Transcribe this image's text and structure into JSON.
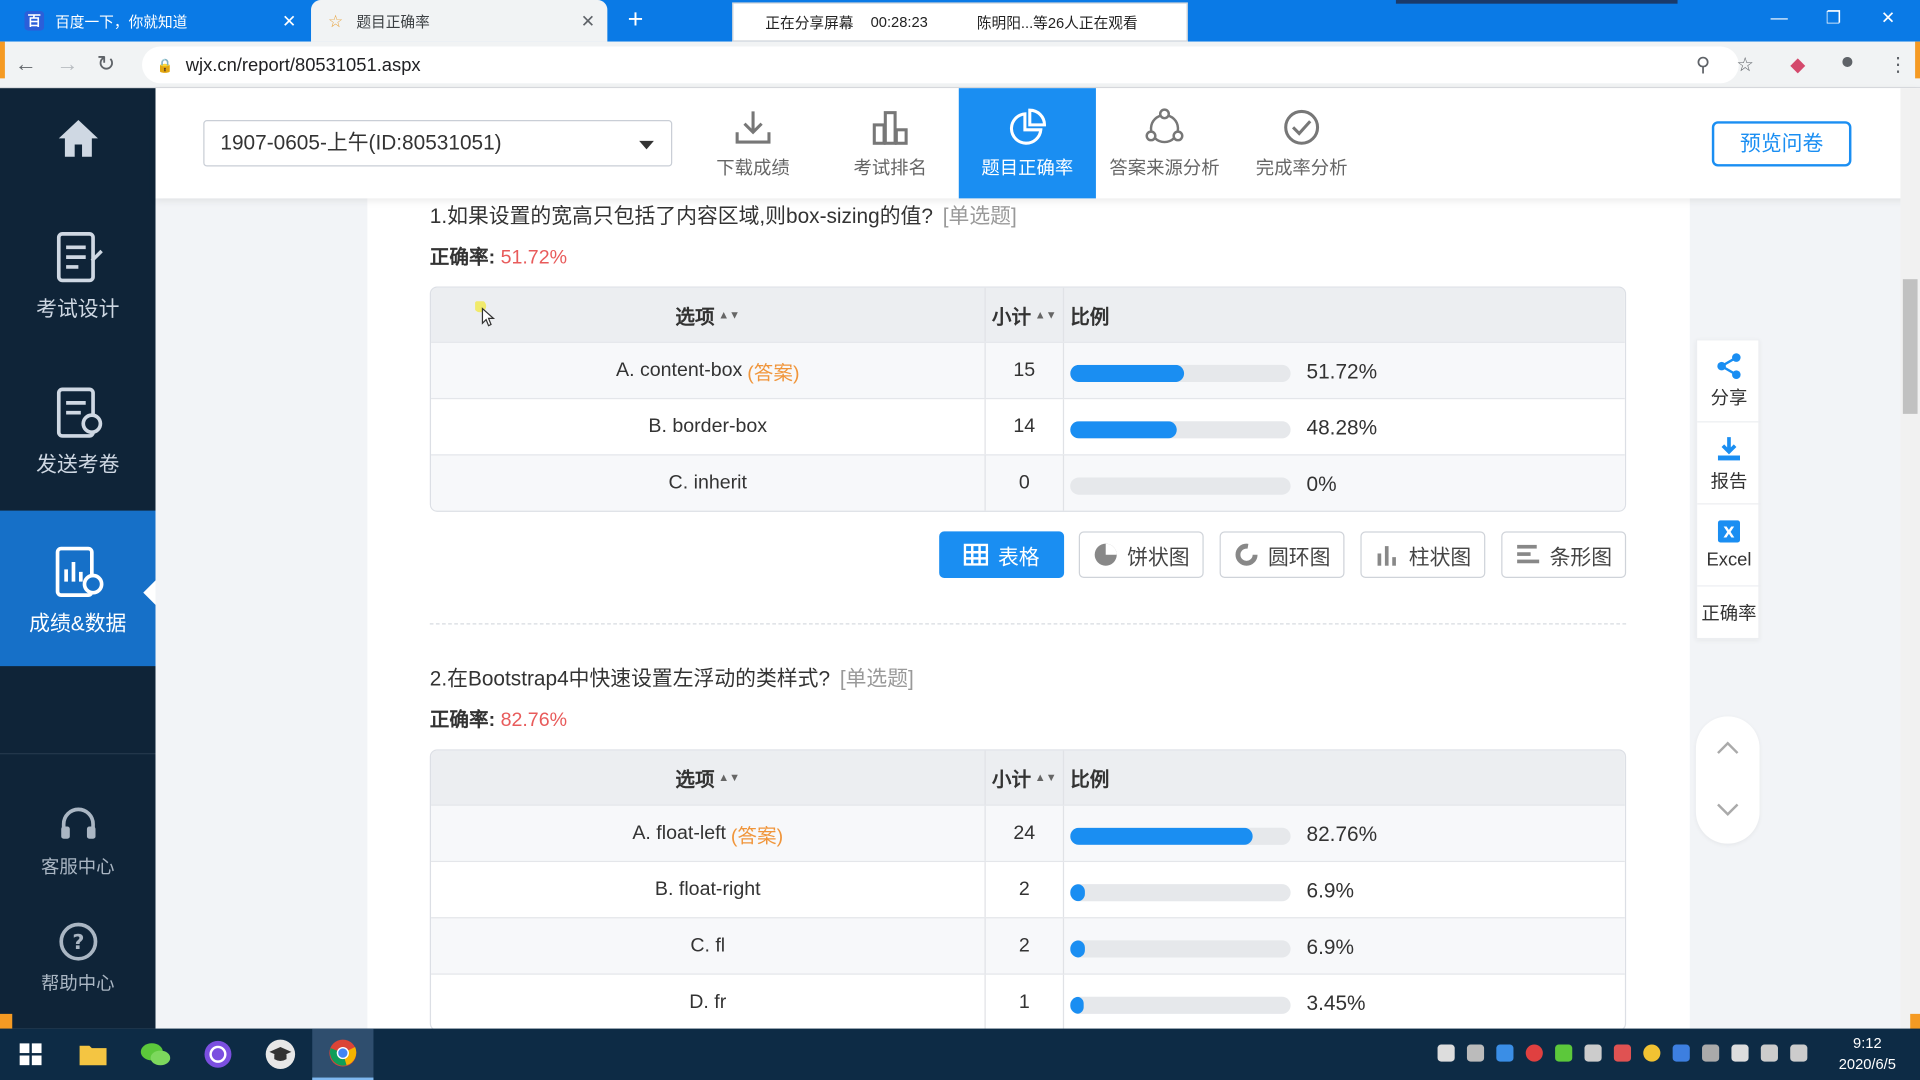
{
  "browser": {
    "tabs": [
      {
        "title": "百度一下，你就知道",
        "favicon": "baidu-paw-icon"
      },
      {
        "title": "题目正确率",
        "favicon": "star-icon"
      }
    ],
    "share_bar": {
      "status": "正在分享屏幕",
      "timer": "00:28:23",
      "viewers": "陈明阳...等26人正在观看"
    },
    "url": "wjx.cn/report/80531051.aspx"
  },
  "sidebar": {
    "items": [
      {
        "label": "",
        "icon": "home-icon"
      },
      {
        "label": "考试设计",
        "icon": "exam-design-icon"
      },
      {
        "label": "发送考卷",
        "icon": "send-paper-icon"
      },
      {
        "label": "成绩&数据",
        "icon": "score-data-icon"
      },
      {
        "label": "客服中心",
        "icon": "headset-icon"
      },
      {
        "label": "帮助中心",
        "icon": "help-icon"
      }
    ]
  },
  "toolbar": {
    "survey_select": "1907-0605-上午(ID:80531051)",
    "buttons": [
      {
        "label": "下载成绩",
        "icon": "download-icon"
      },
      {
        "label": "考试排名",
        "icon": "ranking-icon"
      },
      {
        "label": "题目正确率",
        "icon": "pie-accuracy-icon"
      },
      {
        "label": "答案来源分析",
        "icon": "source-analysis-icon"
      },
      {
        "label": "完成率分析",
        "icon": "check-circle-icon"
      }
    ],
    "preview_label": "预览问卷"
  },
  "table_headers": {
    "option": "选项",
    "count": "小计",
    "ratio": "比例"
  },
  "answer_tag": "(答案)",
  "accuracy_label": "正确率:",
  "questions": [
    {
      "title": "1.如果设置的宽高只包括了内容区域,则box-sizing的值?",
      "type": "[单选题]",
      "accuracy": "51.72%",
      "options": [
        {
          "label": "A. content-box",
          "is_answer": true,
          "count": "15",
          "pct": "51.72%",
          "fill": 0.5172
        },
        {
          "label": "B. border-box",
          "is_answer": false,
          "count": "14",
          "pct": "48.28%",
          "fill": 0.4828
        },
        {
          "label": "C. inherit",
          "is_answer": false,
          "count": "0",
          "pct": "0%",
          "fill": 0
        }
      ]
    },
    {
      "title": "2.在Bootstrap4中快速设置左浮动的类样式?",
      "type": "[单选题]",
      "accuracy": "82.76%",
      "options": [
        {
          "label": "A. float-left",
          "is_answer": true,
          "count": "24",
          "pct": "82.76%",
          "fill": 0.8276
        },
        {
          "label": "B. float-right",
          "is_answer": false,
          "count": "2",
          "pct": "6.9%",
          "fill": 0.069
        },
        {
          "label": "C. fl",
          "is_answer": false,
          "count": "2",
          "pct": "6.9%",
          "fill": 0.069
        },
        {
          "label": "D. fr",
          "is_answer": false,
          "count": "1",
          "pct": "3.45%",
          "fill": 0.0345
        }
      ]
    }
  ],
  "view_buttons": [
    {
      "label": "表格",
      "icon": "table-icon",
      "selected": true
    },
    {
      "label": "饼状图",
      "icon": "pie-chart-icon",
      "selected": false
    },
    {
      "label": "圆环图",
      "icon": "donut-chart-icon",
      "selected": false
    },
    {
      "label": "柱状图",
      "icon": "column-chart-icon",
      "selected": false
    },
    {
      "label": "条形图",
      "icon": "bar-chart-icon",
      "selected": false
    }
  ],
  "right_panel": {
    "share": "分享",
    "report": "报告",
    "excel": "Excel",
    "accuracy": "正确率"
  },
  "taskbar": {
    "time": "9:12",
    "date": "2020/6/5"
  },
  "colors": {
    "accent": "#1a8ef2",
    "sidebar_bg": "#0f2438",
    "accuracy_red": "#e85b5b",
    "answer_orange": "#f0953a"
  }
}
